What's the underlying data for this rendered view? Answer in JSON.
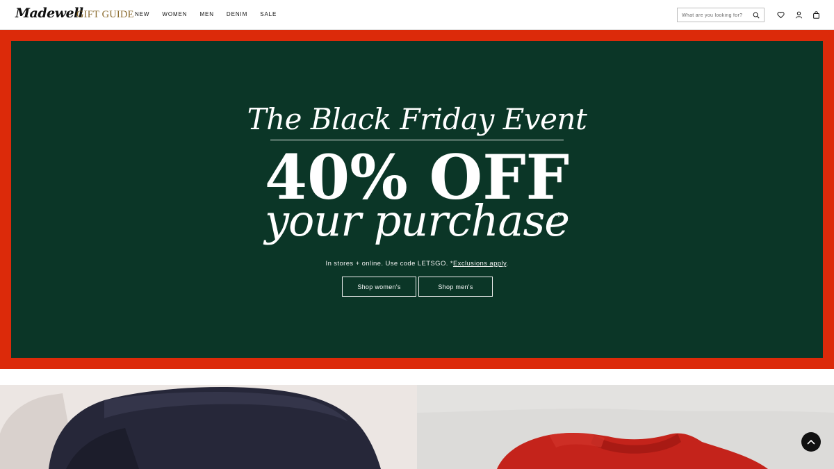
{
  "header": {
    "logo": "Madewell",
    "gift_guide": "GIFT GUIDE",
    "nav": [
      "NEW",
      "WOMEN",
      "MEN",
      "DENIM",
      "SALE"
    ],
    "search_placeholder": "What are you looking for?"
  },
  "promo": {
    "title": "The Black Friday Event",
    "headline": "40% OFF",
    "subheadline": "your purchase",
    "asterisk": "*",
    "note_prefix": "In stores + online. Use code LETSGO. *",
    "note_link": "Exclusions apply",
    "note_suffix": ".",
    "buttons": {
      "women": "Shop women's",
      "men": "Shop men's"
    }
  },
  "colors": {
    "frame": "#dc2a0a",
    "panel": "#0b3627",
    "gift_guide": "#8a6a2c"
  },
  "icons": [
    "search-icon",
    "heart-icon",
    "account-icon",
    "bag-icon",
    "chevron-up-icon"
  ]
}
